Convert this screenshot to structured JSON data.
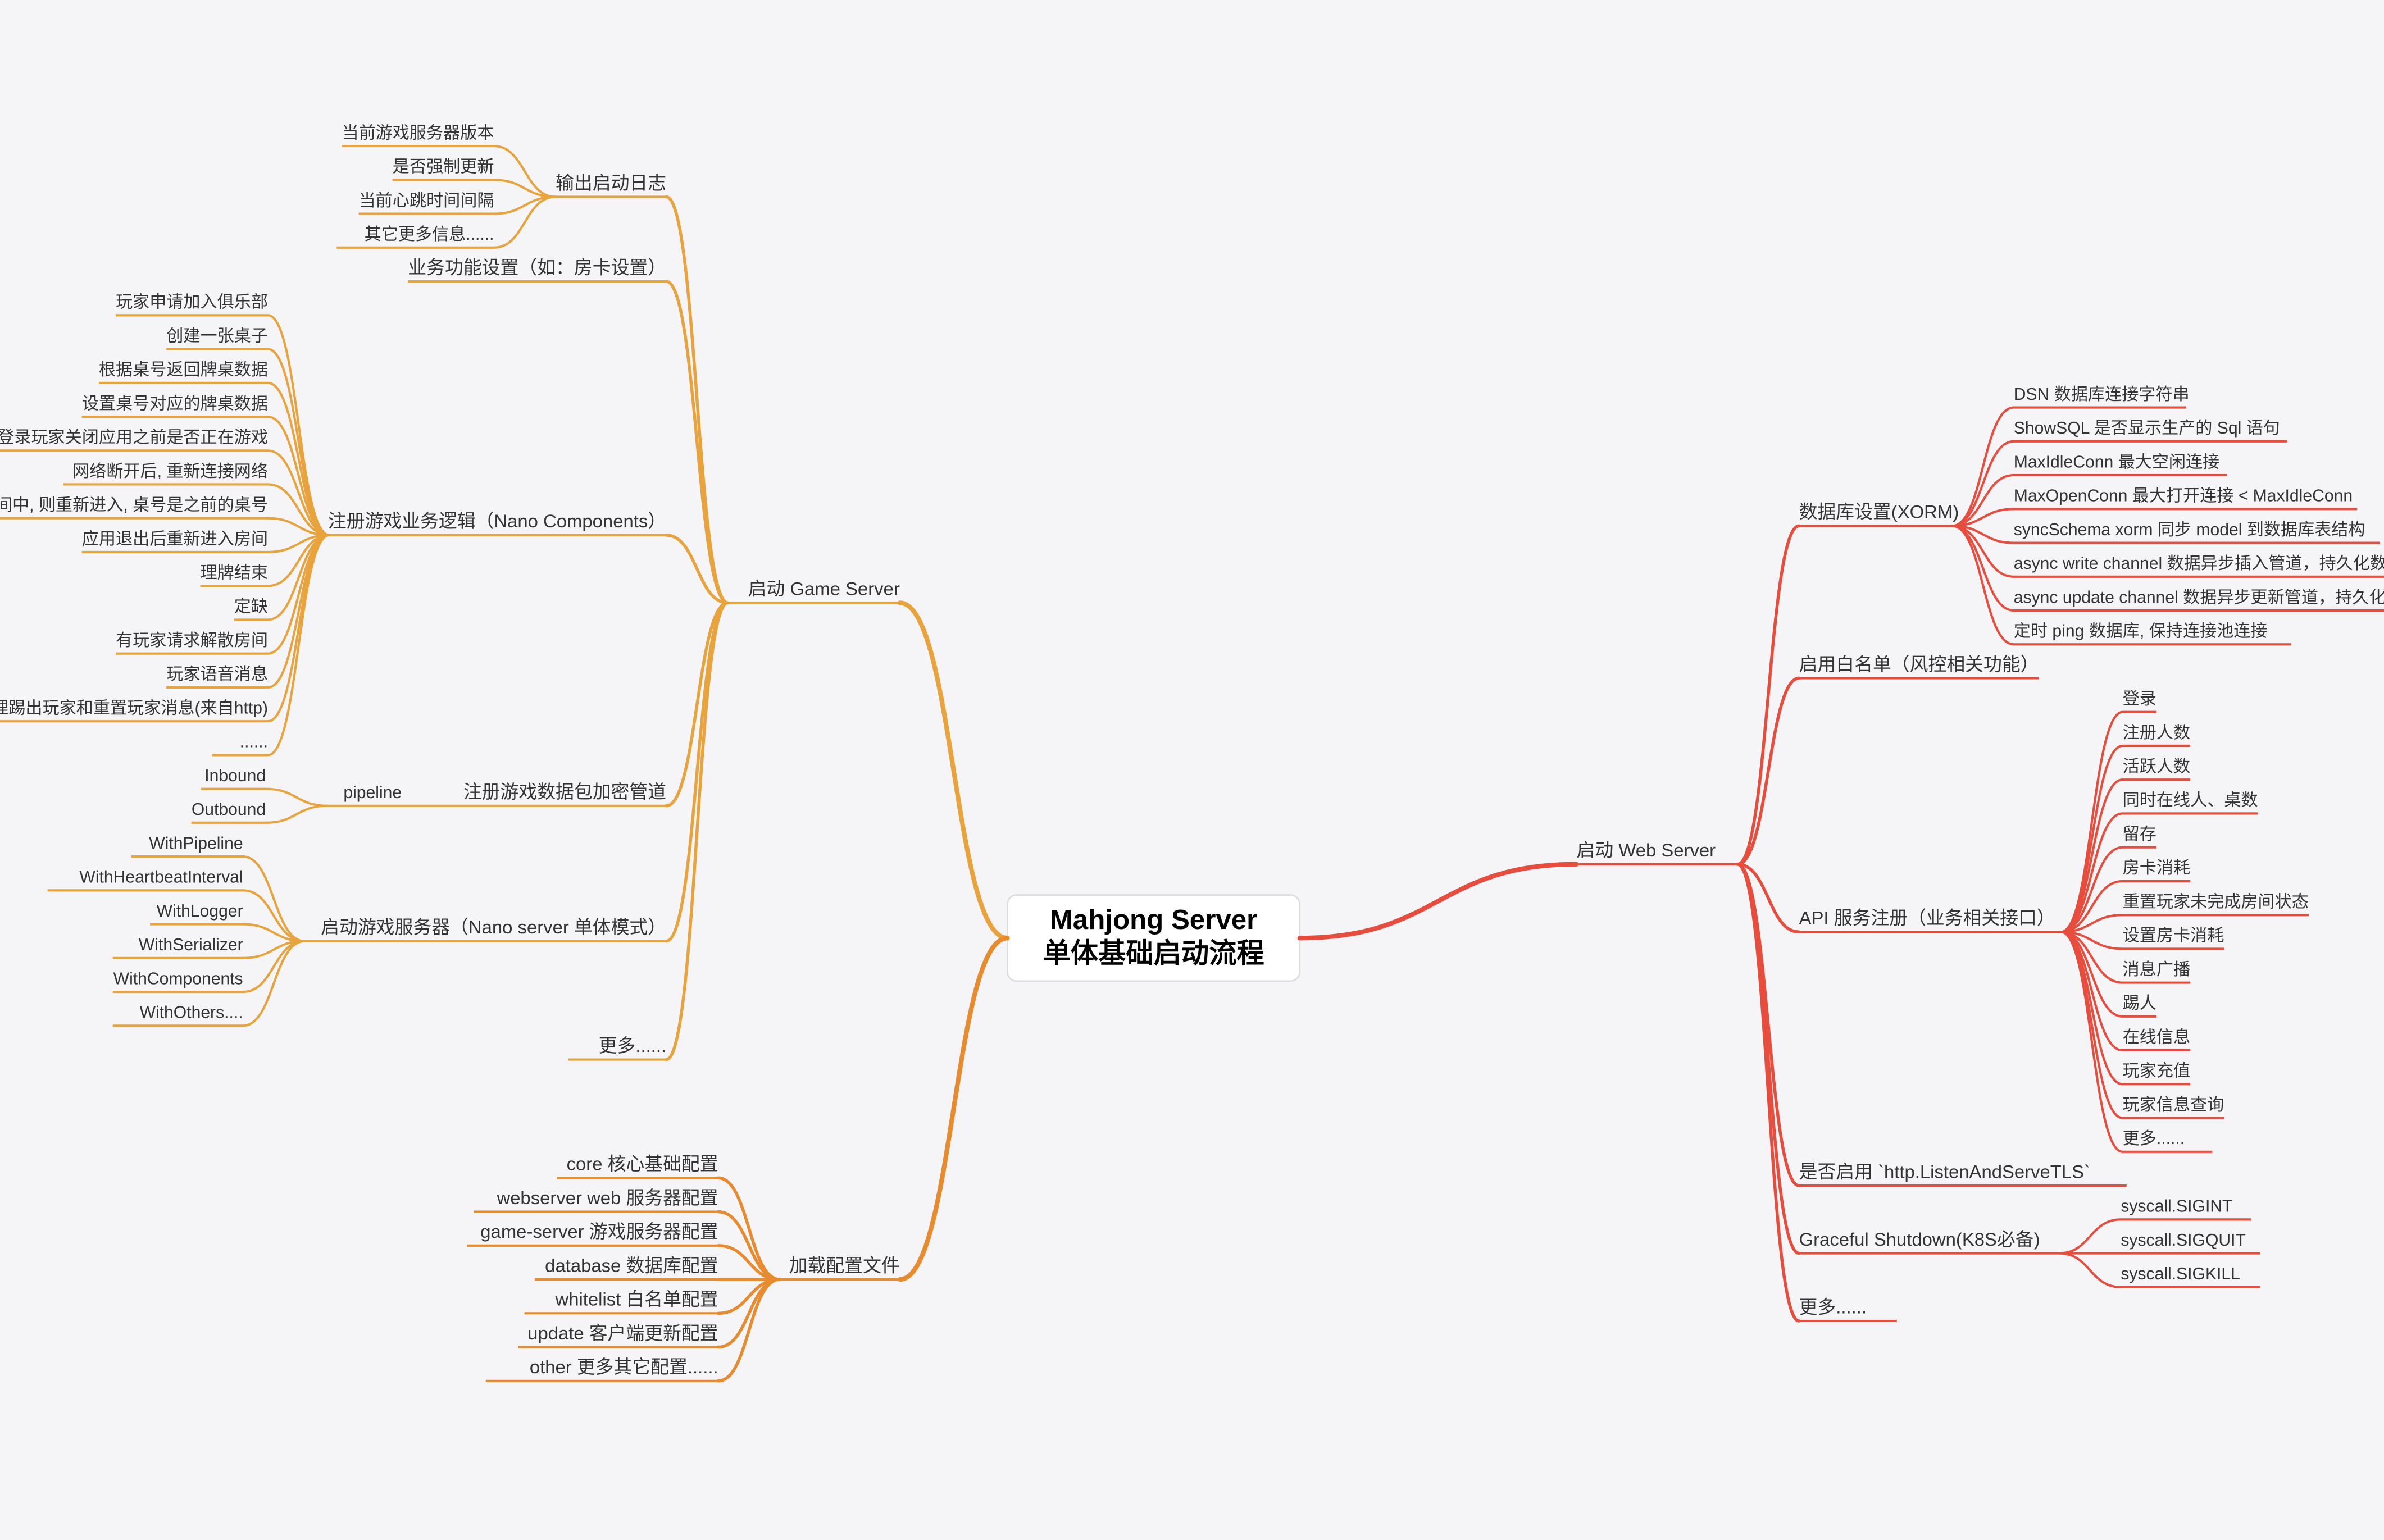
{
  "root": {
    "title_line1": "Mahjong Server",
    "title_line2": "单体基础启动流程"
  },
  "left": [
    {
      "label": "启动 Game Server",
      "color": "#e8a33d",
      "children": [
        {
          "label": "输出启动日志",
          "children": [
            {
              "label": "当前游戏服务器版本"
            },
            {
              "label": "是否强制更新"
            },
            {
              "label": "当前心跳时间间隔"
            },
            {
              "label": "其它更多信息......"
            }
          ]
        },
        {
          "label": "业务功能设置（如：房卡设置）",
          "children": []
        },
        {
          "label": "注册游戏业务逻辑（Nano Components）",
          "children": [
            {
              "label": "玩家申请加入俱乐部"
            },
            {
              "label": "创建一张桌子"
            },
            {
              "label": "根据桌号返回牌桌数据"
            },
            {
              "label": "设置桌号对应的牌桌数据"
            },
            {
              "label": "检查登录玩家关闭应用之前是否正在游戏"
            },
            {
              "label": "网络断开后, 重新连接网络"
            },
            {
              "label": "网络断开后, 如果ReConnect后发现当前正在房间中, 则重新进入, 桌号是之前的桌号"
            },
            {
              "label": "应用退出后重新进入房间"
            },
            {
              "label": "理牌结束"
            },
            {
              "label": "定缺"
            },
            {
              "label": "有玩家请求解散房间"
            },
            {
              "label": "玩家语音消息"
            },
            {
              "label": "处理踢出玩家和重置玩家消息(来自http)"
            },
            {
              "label": "......"
            }
          ]
        },
        {
          "label": "注册游戏数据包加密管道",
          "children": [
            {
              "label": "pipeline",
              "children": [
                {
                  "label": "Inbound"
                },
                {
                  "label": "Outbound"
                }
              ]
            }
          ]
        },
        {
          "label": "启动游戏服务器（Nano server 单体模式）",
          "children": [
            {
              "label": "WithPipeline"
            },
            {
              "label": "WithHeartbeatInterval"
            },
            {
              "label": "WithLogger"
            },
            {
              "label": "WithSerializer"
            },
            {
              "label": "WithComponents"
            },
            {
              "label": "WithOthers...."
            }
          ]
        },
        {
          "label": "更多......",
          "children": []
        }
      ]
    },
    {
      "label": "加载配置文件",
      "color": "#e88b2e",
      "children": [
        {
          "label": "core 核心基础配置"
        },
        {
          "label": "webserver  web 服务器配置"
        },
        {
          "label": "game-server 游戏服务器配置"
        },
        {
          "label": "database 数据库配置"
        },
        {
          "label": "whitelist 白名单配置"
        },
        {
          "label": "update 客户端更新配置"
        },
        {
          "label": "other 更多其它配置......"
        }
      ]
    }
  ],
  "right": [
    {
      "label": "启动 Web Server",
      "color": "#e84c3d",
      "children": [
        {
          "label": "数据库设置(XORM)",
          "children": [
            {
              "label": "DSN 数据库连接字符串"
            },
            {
              "label": "ShowSQL 是否显示生产的 Sql 语句"
            },
            {
              "label": "MaxIdleConn 最大空闲连接"
            },
            {
              "label": "MaxOpenConn 最大打开连接 < MaxIdleConn"
            },
            {
              "label": "syncSchema xorm 同步 model 到数据库表结构"
            },
            {
              "label": "async write channel 数据异步插入管道，持久化数据"
            },
            {
              "label": "async update channel 数据异步更新管道，持久化数据"
            },
            {
              "label": "定时 ping 数据库, 保持连接池连接"
            }
          ]
        },
        {
          "label": "启用白名单（风控相关功能）",
          "children": []
        },
        {
          "label": "API 服务注册（业务相关接口）",
          "children": [
            {
              "label": "登录"
            },
            {
              "label": "注册人数"
            },
            {
              "label": "活跃人数"
            },
            {
              "label": "同时在线人、桌数"
            },
            {
              "label": "留存"
            },
            {
              "label": "房卡消耗"
            },
            {
              "label": "重置玩家未完成房间状态"
            },
            {
              "label": "设置房卡消耗"
            },
            {
              "label": "消息广播"
            },
            {
              "label": "踢人"
            },
            {
              "label": "在线信息"
            },
            {
              "label": "玩家充值"
            },
            {
              "label": "玩家信息查询"
            },
            {
              "label": "更多......"
            }
          ]
        },
        {
          "label": "是否启用 `http.ListenAndServeTLS`",
          "children": []
        },
        {
          "label": "Graceful Shutdown(K8S必备)",
          "children": [
            {
              "label": "syscall.SIGINT"
            },
            {
              "label": "syscall.SIGQUIT"
            },
            {
              "label": "syscall.SIGKILL"
            }
          ]
        },
        {
          "label": "更多......",
          "children": []
        }
      ]
    }
  ]
}
